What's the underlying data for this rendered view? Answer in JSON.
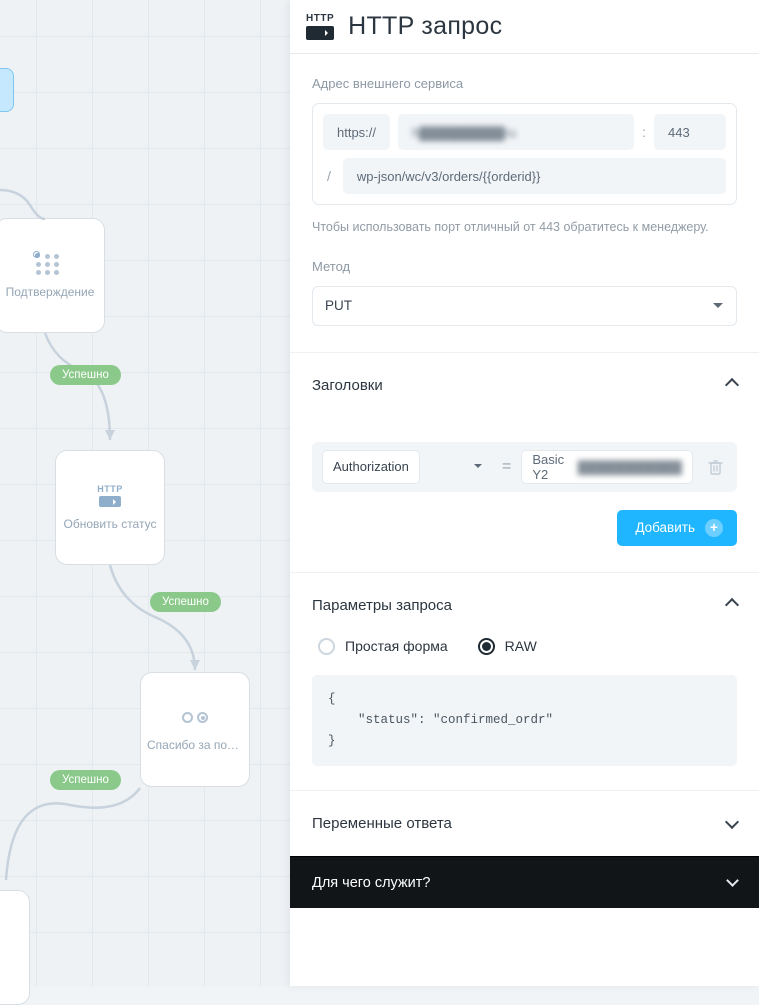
{
  "panel": {
    "http_label": "HTTP",
    "title": "HTTP запрос"
  },
  "address": {
    "label": "Адрес внешнего сервиса",
    "scheme": "https://",
    "host_masked": "h▓▓▓▓▓▓▓▓▓ru",
    "colon": ":",
    "port": "443",
    "slash": "/",
    "path": "wp-json/wc/v3/orders/{{orderid}}",
    "hint": "Чтобы использовать порт отличный от 443 обратитесь к менеджеру."
  },
  "method": {
    "label": "Метод",
    "value": "PUT"
  },
  "headers": {
    "title": "Заголовки",
    "rows": [
      {
        "key": "Authorization",
        "eq": "=",
        "value_prefix": "Basic Y2",
        "value_masked": "▓▓▓▓▓▓▓▓▓▓▓"
      }
    ],
    "add_label": "Добавить"
  },
  "params": {
    "title": "Параметры запроса",
    "mode_simple": "Простая форма",
    "mode_raw": "RAW",
    "selected": "raw",
    "body": "{\n    \"status\": \"confirmed_ordr\"\n}"
  },
  "vars": {
    "title": "Переменные ответа"
  },
  "help": {
    "title": "Для чего служит?"
  },
  "canvas": {
    "nodes": {
      "confirm": "Подтверждение",
      "update": "Обновить статус",
      "thanks": "Спасибо за подт…"
    },
    "badge_success": "Успешно",
    "http_label": "HTTP"
  }
}
